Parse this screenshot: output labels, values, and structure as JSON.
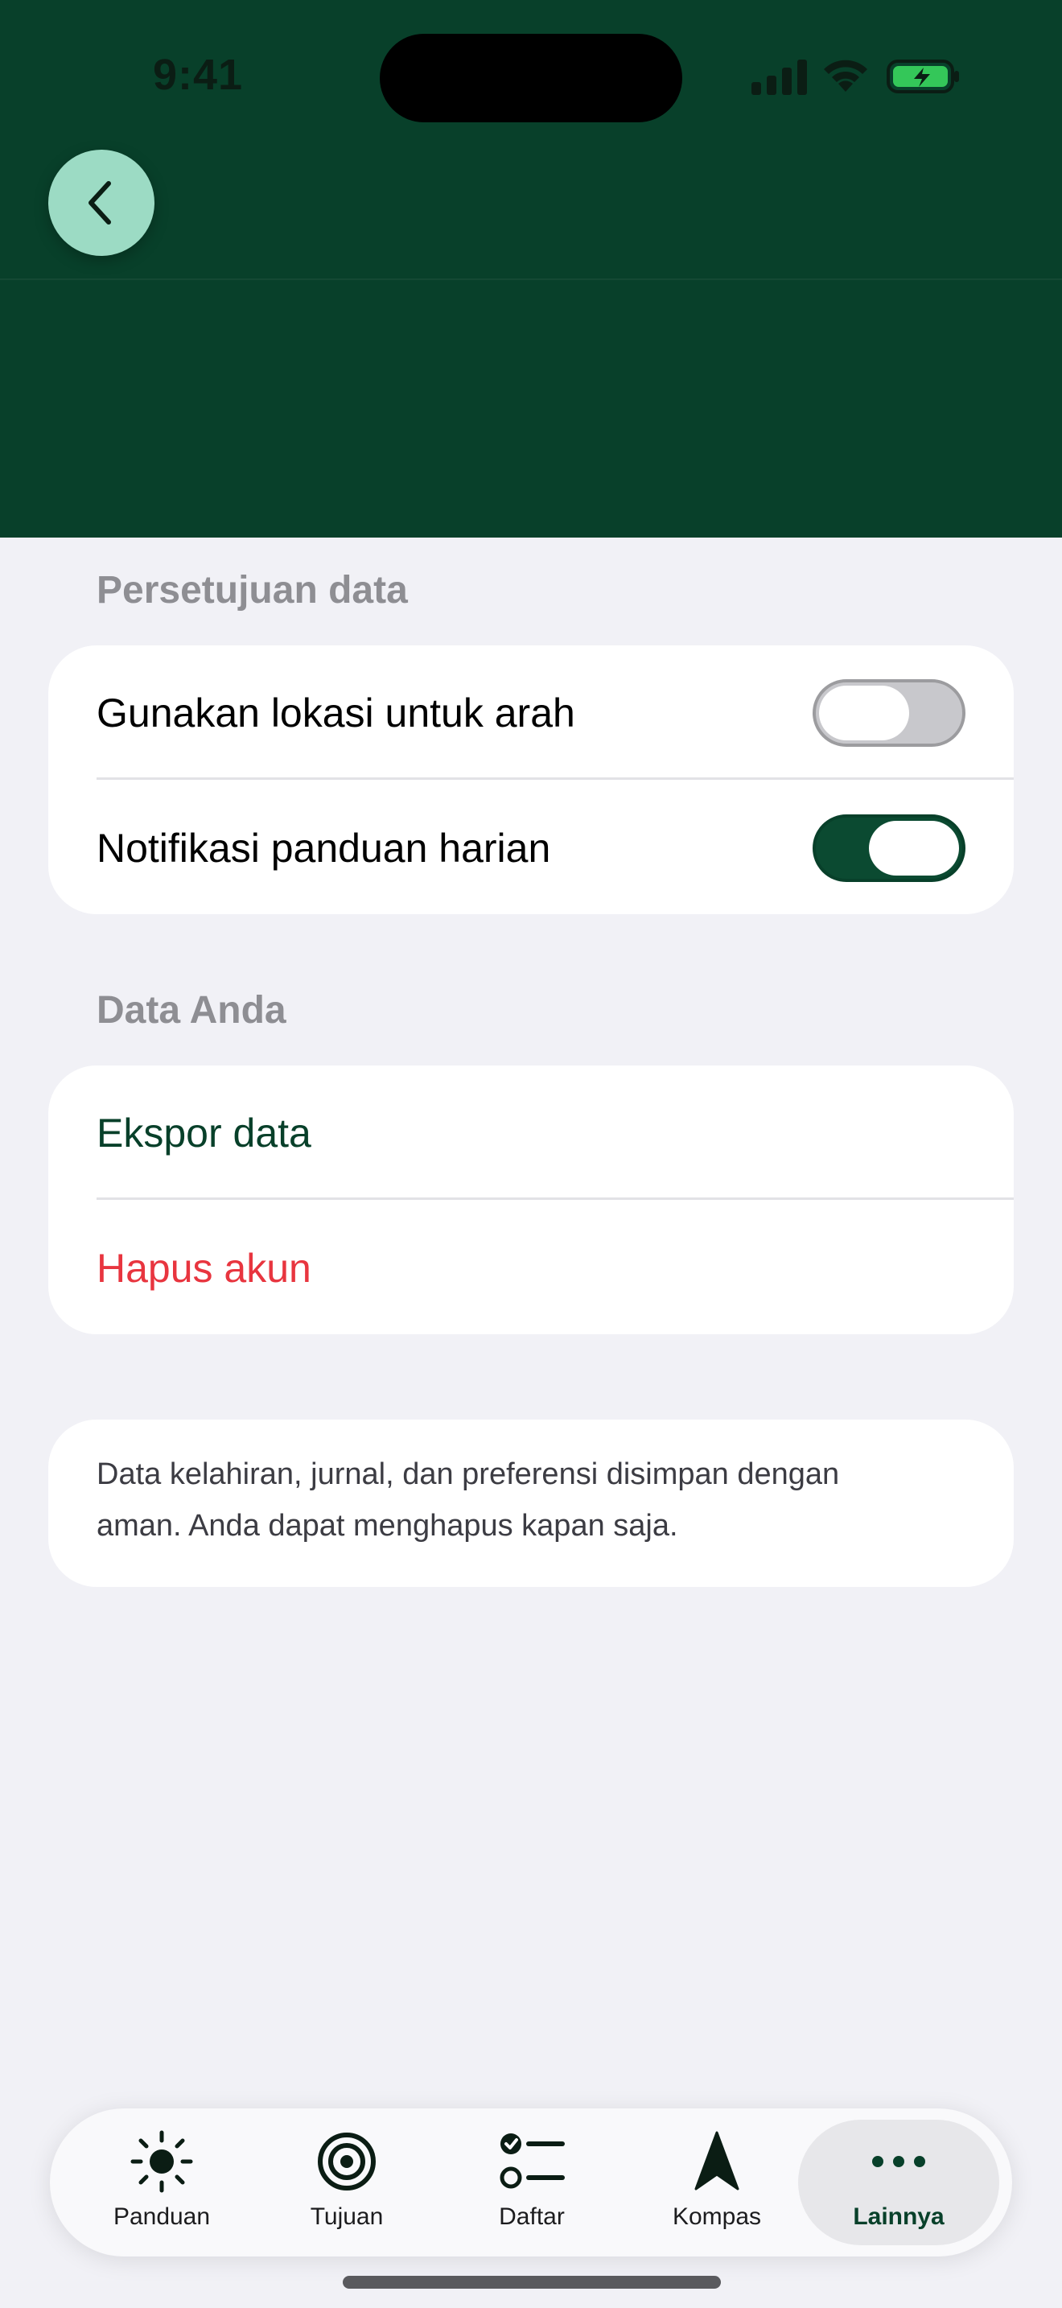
{
  "status_bar": {
    "time": "9:41"
  },
  "header": {
    "back_icon": "chevron-left-icon"
  },
  "sections": {
    "consent": {
      "title": "Persetujuan data",
      "rows": [
        {
          "label": "Gunakan lokasi untuk arah",
          "toggle": "off"
        },
        {
          "label": "Notifikasi panduan harian",
          "toggle": "on"
        }
      ]
    },
    "your_data": {
      "title": "Data Anda",
      "rows": [
        {
          "label": "Ekspor data",
          "color": "#08402A"
        },
        {
          "label": "Hapus akun",
          "color": "#E8353F"
        }
      ]
    }
  },
  "info": {
    "line1": "Data kelahiran, jurnal, dan preferensi disimpan dengan",
    "line2": "aman. Anda dapat menghapus kapan saja."
  },
  "tabbar": {
    "tabs": [
      {
        "label": "Panduan",
        "icon": "sun-icon"
      },
      {
        "label": "Tujuan",
        "icon": "target-icon"
      },
      {
        "label": "Daftar",
        "icon": "checklist-icon"
      },
      {
        "label": "Kompas",
        "icon": "navigation-arrow-icon"
      },
      {
        "label": "Lainnya",
        "icon": "ellipsis-icon",
        "active": true
      }
    ]
  },
  "colors": {
    "brand_dark_green": "#08402A",
    "back_button": "#9CDBC4",
    "destructive": "#E8353F",
    "background": "#F1F1F6"
  }
}
